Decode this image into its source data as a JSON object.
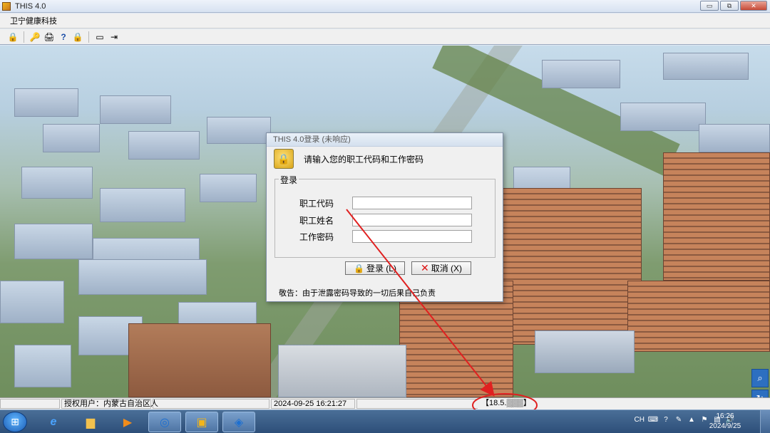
{
  "window": {
    "title": "THIS 4.0",
    "controls": {
      "minimize": "▭",
      "restore": "⧉",
      "close": "✕"
    }
  },
  "menu": {
    "items": [
      "卫宁健康科技"
    ]
  },
  "toolbar": {
    "icons": [
      "lock-icon",
      "key-icon",
      "printer-icon",
      "help-icon",
      "lock-icon",
      "card-icon",
      "exit-icon"
    ]
  },
  "dialog": {
    "title": "THIS 4.0登录 (未响应)",
    "prompt": "请输入您的职工代码和工作密码",
    "group_label": "登录",
    "fields": {
      "code_label": "职工代码",
      "name_label": "职工姓名",
      "password_label": "工作密码",
      "code_value": "",
      "name_value": "",
      "password_value": ""
    },
    "buttons": {
      "login": "登录 (L)",
      "cancel": "取消 (X)"
    },
    "warning": "敬告：由于泄露密码导致的一切后果自己负责"
  },
  "statusbar": {
    "auth_user": "授权用户：内蒙古自治区人",
    "datetime": "2024-09-25 16:21:27",
    "ip": "【18.5.▒▒▒】"
  },
  "taskbar": {
    "apps": [
      "ie-icon",
      "folder-icon",
      "media-player-icon",
      "browser-icon",
      "app-icon",
      "client-icon"
    ],
    "tray": {
      "lang": "CH"
    },
    "clock": {
      "time": "16:26",
      "date": "2024/9/25"
    }
  },
  "colors": {
    "annotation": "#e02020",
    "taskbar": "#2d4f79"
  }
}
